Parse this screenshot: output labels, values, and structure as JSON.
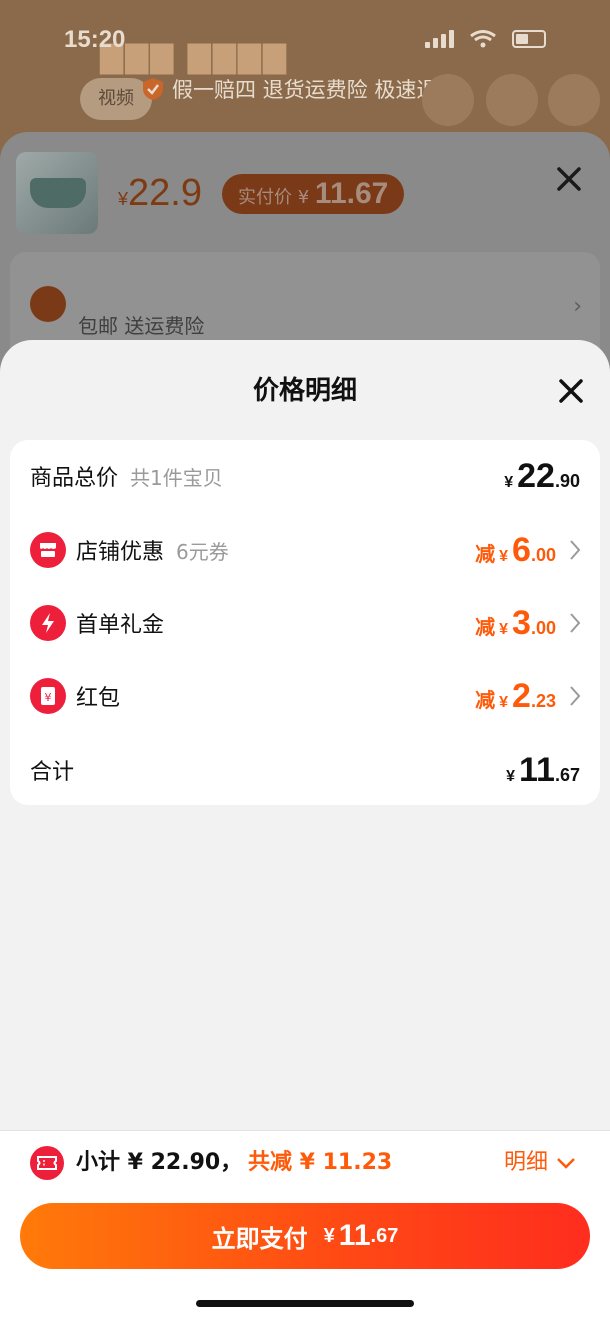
{
  "status_bar": {
    "time": "15:20"
  },
  "background": {
    "video_tab": "视频",
    "guarantee": "假一赔四 退货运费险 极速退款",
    "product_price_symbol": "¥",
    "product_price": "22.9",
    "pay_price_label": "实付价",
    "pay_price_symbol": "¥",
    "pay_price": "11.67",
    "shipping": "包邮  送运费险"
  },
  "sheet": {
    "title": "价格明细",
    "rows": [
      {
        "label": "商品总价",
        "sub": "共1件宝贝",
        "prefix": "",
        "yen": "¥",
        "int": "22",
        "dec": ".90"
      },
      {
        "label": "店铺优惠",
        "sub": "6元券",
        "prefix": "减",
        "yen": "¥",
        "int": "6",
        "dec": ".00",
        "icon": "store-coupon-icon",
        "icon_color": "#ee1f3a"
      },
      {
        "label": "首单礼金",
        "sub": "",
        "prefix": "减",
        "yen": "¥",
        "int": "3",
        "dec": ".00",
        "icon": "lightning-icon",
        "icon_color": "#ee1f3a"
      },
      {
        "label": "红包",
        "sub": "",
        "prefix": "减",
        "yen": "¥",
        "int": "2",
        "dec": ".23",
        "icon": "red-packet-icon",
        "icon_color": "#ee1f3a"
      },
      {
        "label": "合计",
        "sub": "",
        "prefix": "",
        "yen": "¥",
        "int": "11",
        "dec": ".67"
      }
    ]
  },
  "bottom_bar": {
    "subtotal": "小计 ¥ 22.90，",
    "total_discount": "共减 ¥ 11.23",
    "detail_label": "明细",
    "pay_label": "立即支付",
    "pay_yen": "¥",
    "pay_int": "11",
    "pay_dec": ".67"
  },
  "colors": {
    "accent": "#ff5a0a",
    "icon_red": "#ee1f3a",
    "button_start": "#ff7a0a",
    "button_end": "#ff2d1e"
  }
}
